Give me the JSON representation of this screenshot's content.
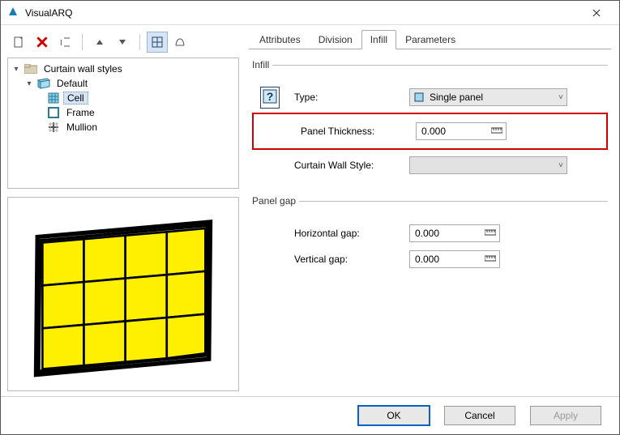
{
  "window": {
    "title": "VisualARQ"
  },
  "tree": {
    "root": {
      "label": "Curtain wall styles"
    },
    "default": {
      "label": "Default"
    },
    "children": [
      {
        "label": "Cell",
        "selected": true
      },
      {
        "label": "Frame",
        "selected": false
      },
      {
        "label": "Mullion",
        "selected": false
      }
    ]
  },
  "tabs": [
    {
      "label": "Attributes"
    },
    {
      "label": "Division"
    },
    {
      "label": "Infill",
      "active": true
    },
    {
      "label": "Parameters"
    }
  ],
  "infill_group": {
    "legend": "Infill",
    "type_label": "Type:",
    "type_value": "Single panel",
    "thickness_label": "Panel Thickness:",
    "thickness_value": "0.000",
    "style_label": "Curtain Wall Style:",
    "style_value": ""
  },
  "panelgap_group": {
    "legend": "Panel gap",
    "hgap_label": "Horizontal gap:",
    "hgap_value": "0.000",
    "vgap_label": "Vertical gap:",
    "vgap_value": "0.000"
  },
  "buttons": {
    "ok": "OK",
    "cancel": "Cancel",
    "apply": "Apply"
  },
  "icons": {
    "ruler_glyph": "📏"
  }
}
